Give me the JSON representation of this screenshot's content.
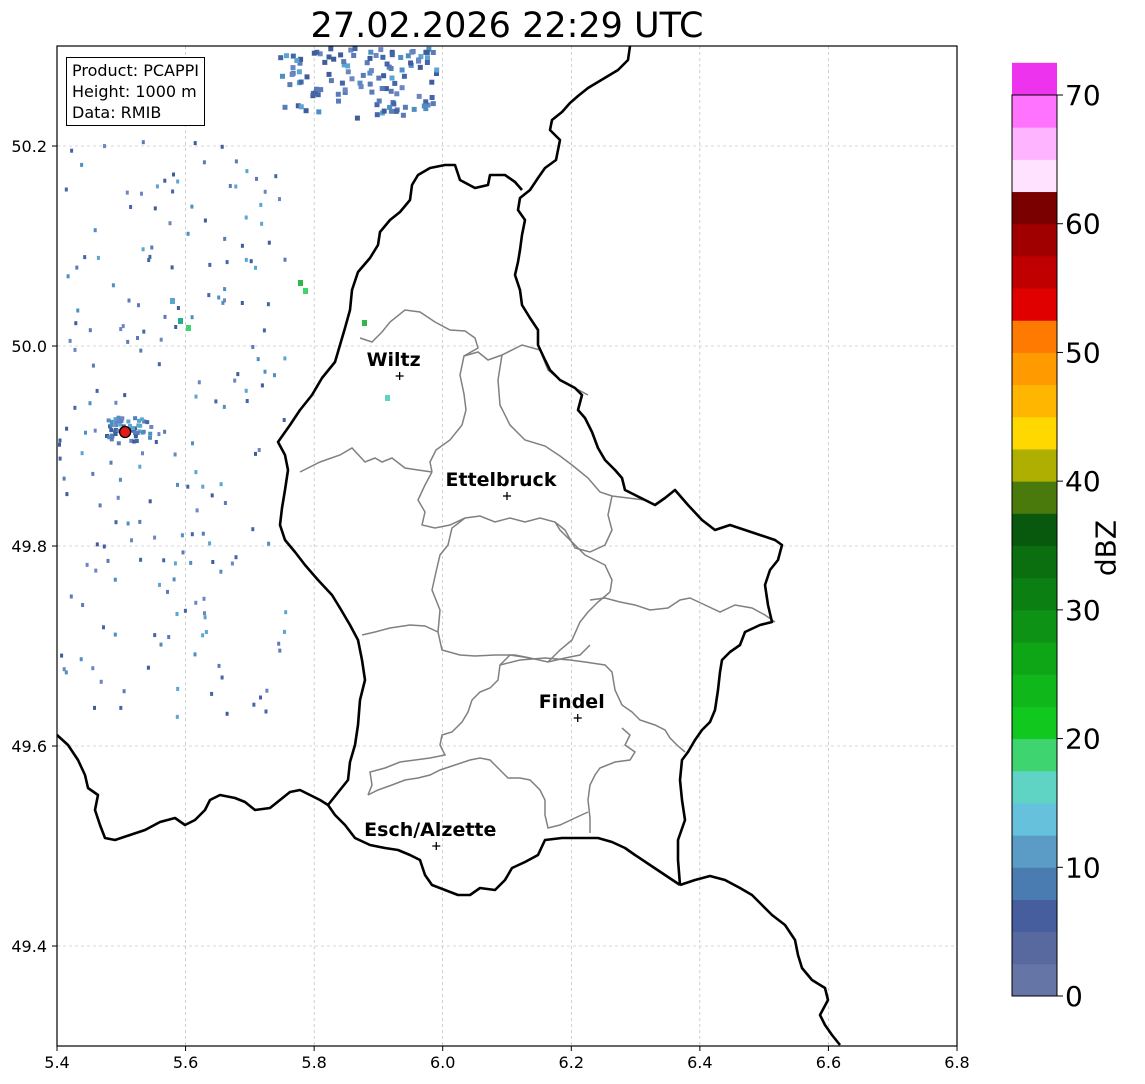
{
  "title": "27.02.2026 22:29 UTC",
  "info": {
    "product": "Product: PCAPPI",
    "height": "Height: 1000 m",
    "data": "Data: RMIB"
  },
  "map": {
    "lon_range": [
      5.4,
      6.8
    ],
    "lat_range": [
      49.3,
      50.3
    ],
    "x_ticks": [
      "5.4",
      "5.6",
      "5.8",
      "6.0",
      "6.2",
      "6.4",
      "6.6",
      "6.8"
    ],
    "y_ticks": [
      "49.4",
      "49.6",
      "49.8",
      "50.0",
      "50.2"
    ],
    "grid": true,
    "cities": [
      {
        "name": "Wiltz",
        "lon": 5.933,
        "lat": 49.97
      },
      {
        "name": "Ettelbruck",
        "lon": 6.1,
        "lat": 49.85
      },
      {
        "name": "Findel",
        "lon": 6.21,
        "lat": 49.628
      },
      {
        "name": "Esch/Alzette",
        "lon": 5.99,
        "lat": 49.5
      }
    ],
    "radar_site": {
      "lon": 5.506,
      "lat": 49.914,
      "color": "#e31a1c"
    }
  },
  "colorbar": {
    "label": "dBZ",
    "ticks": [
      "0",
      "10",
      "20",
      "30",
      "40",
      "50",
      "60",
      "70"
    ],
    "min": 0,
    "max": 70,
    "step": 2.5,
    "colors": [
      "#6475a6",
      "#5869a0",
      "#465e9d",
      "#4a7bb1",
      "#5a9cc6",
      "#66c2dc",
      "#5fd3c4",
      "#3ed46f",
      "#11c81e",
      "#0fb71b",
      "#0ea617",
      "#0d9215",
      "#0b7f11",
      "#0b6f0f",
      "#08590d",
      "#4a7a0c",
      "#aeaf00",
      "#ffd800",
      "#ffb600",
      "#ff9a00",
      "#ff7a00",
      "#e10000",
      "#c00000",
      "#a10000",
      "#7a0000",
      "#ffe2ff",
      "#ffb4ff",
      "#ff73ff",
      "#ee33ee"
    ]
  }
}
